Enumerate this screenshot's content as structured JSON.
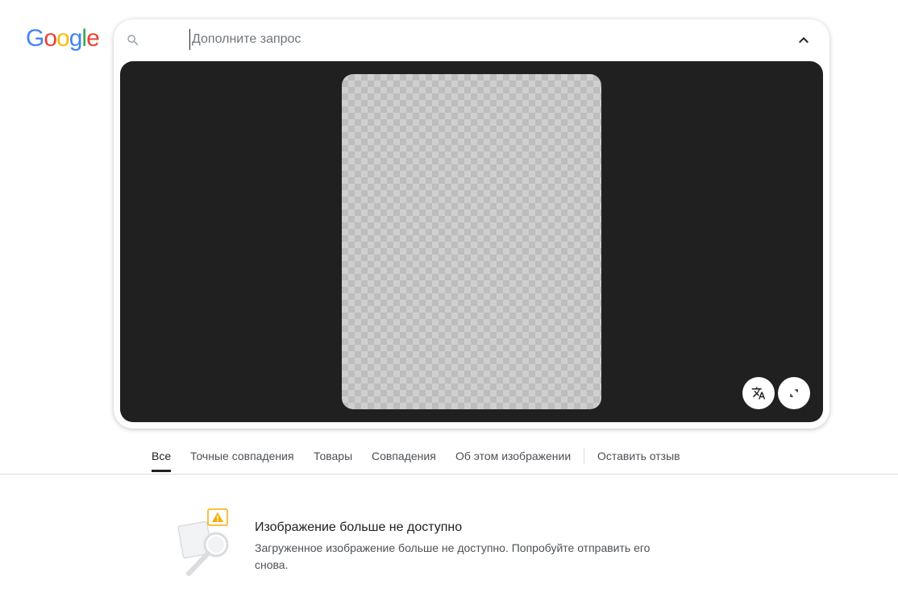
{
  "logo": {
    "letters": [
      "G",
      "o",
      "o",
      "g",
      "l",
      "e"
    ],
    "colors": [
      "#4285F4",
      "#EA4335",
      "#FBBC05",
      "#4285F4",
      "#34A853",
      "#EA4335"
    ]
  },
  "search": {
    "placeholder": "Дополните запрос",
    "value": ""
  },
  "viewer": {
    "background": "#202020",
    "buttons": [
      "translate-icon",
      "expand-icon"
    ]
  },
  "tabs": [
    {
      "label": "Все",
      "active": true
    },
    {
      "label": "Точные совпадения",
      "active": false
    },
    {
      "label": "Товары",
      "active": false
    },
    {
      "label": "Совпадения",
      "active": false
    },
    {
      "label": "Об этом изображении",
      "active": false
    },
    {
      "label": "Оставить отзыв",
      "active": false
    }
  ],
  "notice": {
    "title": "Изображение больше не доступно",
    "text": "Загруженное изображение больше не доступно. Попробуйте отправить его снова."
  },
  "colors": {
    "warning": "#F9AB00",
    "text_primary": "#202124",
    "text_secondary": "#4d5156"
  }
}
